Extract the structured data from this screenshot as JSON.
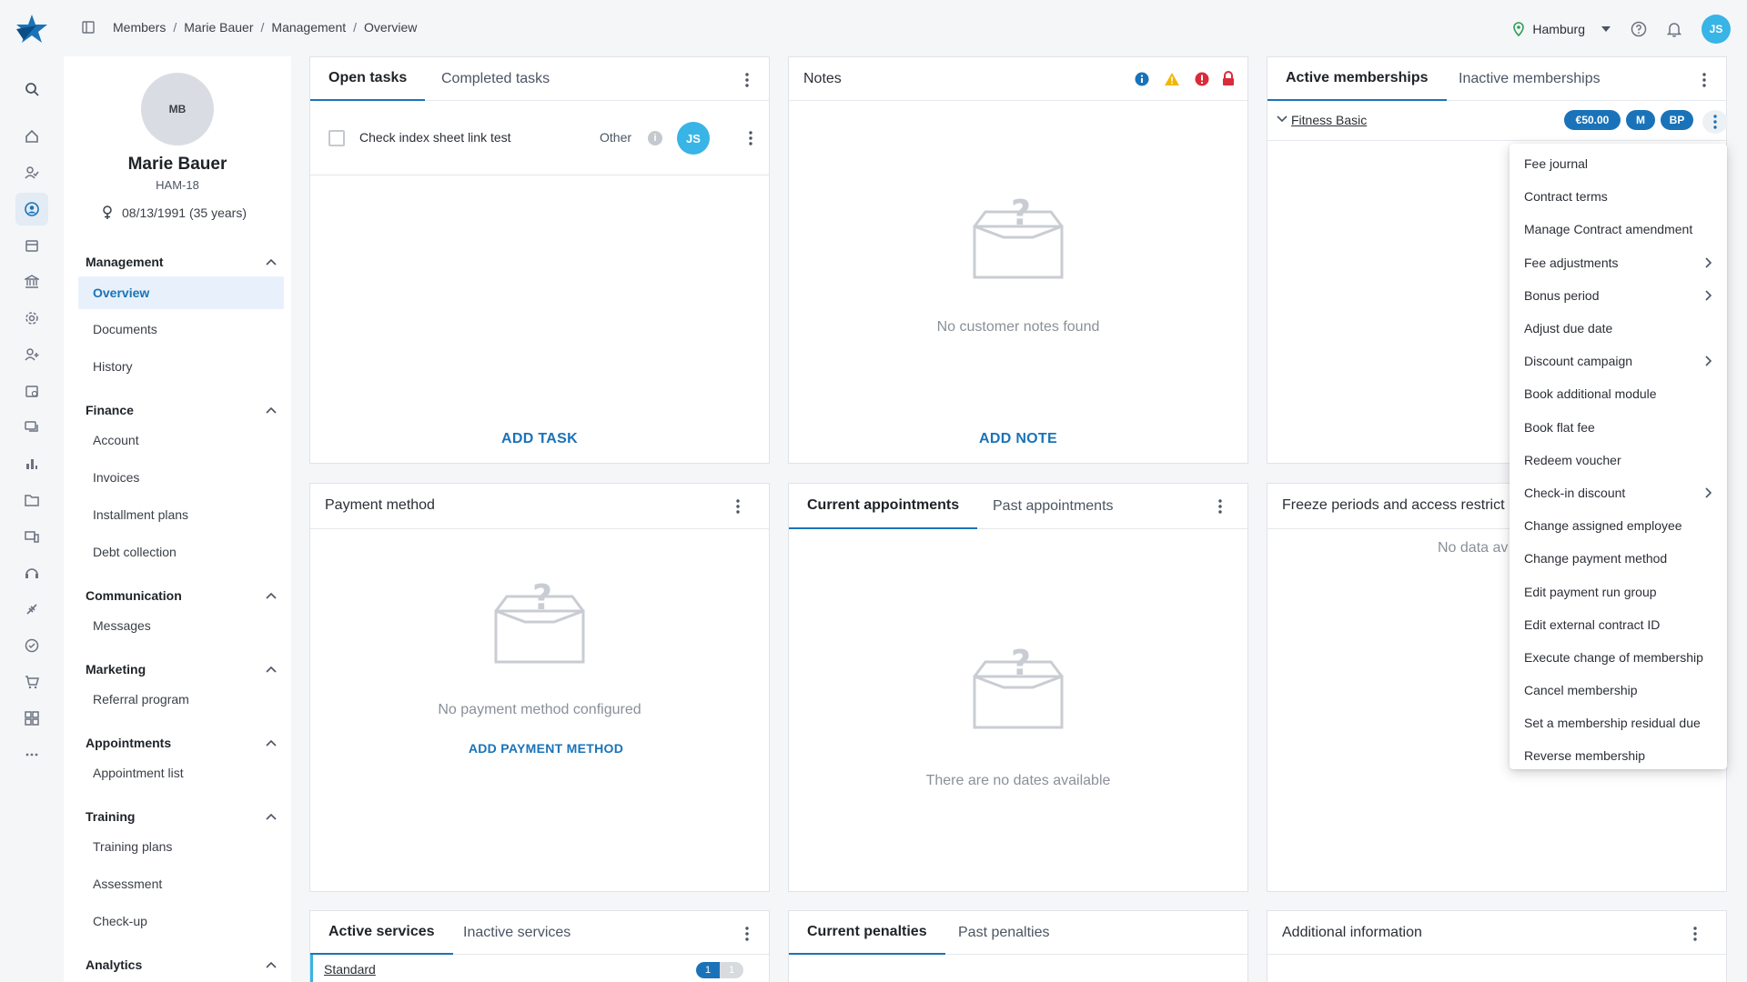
{
  "breadcrumb": [
    "Members",
    "Marie Bauer",
    "Management",
    "Overview"
  ],
  "breadcrumb_sep": "/",
  "topbar": {
    "studio": "Hamburg",
    "user_initials": "JS"
  },
  "member": {
    "initials": "MB",
    "name": "Marie Bauer",
    "id": "HAM-18",
    "dob": "08/13/1991 (35 years)"
  },
  "nav": {
    "management": {
      "label": "Management",
      "items": [
        "Overview",
        "Documents",
        "History"
      ]
    },
    "finance": {
      "label": "Finance",
      "items": [
        "Account",
        "Invoices",
        "Installment plans",
        "Debt collection"
      ]
    },
    "communication": {
      "label": "Communication",
      "items": [
        "Messages"
      ]
    },
    "marketing": {
      "label": "Marketing",
      "items": [
        "Referral program"
      ]
    },
    "appointments": {
      "label": "Appointments",
      "items": [
        "Appointment list"
      ]
    },
    "training": {
      "label": "Training",
      "items": [
        "Training plans",
        "Assessment",
        "Check-up"
      ]
    },
    "analytics": {
      "label": "Analytics"
    }
  },
  "tasks": {
    "tabs": [
      "Open tasks",
      "Completed tasks"
    ],
    "row": {
      "text": "Check index sheet link test",
      "category": "Other",
      "assignee": "JS",
      "info": "i"
    },
    "action": "ADD TASK"
  },
  "notes": {
    "title": "Notes",
    "empty": "No customer notes found",
    "action": "ADD NOTE"
  },
  "memberships": {
    "tabs": [
      "Active memberships",
      "Inactive memberships"
    ],
    "row": {
      "name": "Fitness Basic",
      "price": "€50.00",
      "badge1": "M",
      "badge2": "BP"
    },
    "menu": [
      {
        "label": "Fee journal",
        "sub": false
      },
      {
        "label": "Contract terms",
        "sub": false
      },
      {
        "label": "Manage Contract amendment",
        "sub": false
      },
      {
        "label": "Fee adjustments",
        "sub": true
      },
      {
        "label": "Bonus period",
        "sub": true
      },
      {
        "label": "Adjust due date",
        "sub": false
      },
      {
        "label": "Discount campaign",
        "sub": true
      },
      {
        "label": "Book additional module",
        "sub": false
      },
      {
        "label": "Book flat fee",
        "sub": false
      },
      {
        "label": "Redeem voucher",
        "sub": false
      },
      {
        "label": "Check-in discount",
        "sub": true
      },
      {
        "label": "Change assigned employee",
        "sub": false
      },
      {
        "label": "Change payment method",
        "sub": false
      },
      {
        "label": "Edit payment run group",
        "sub": false
      },
      {
        "label": "Edit external contract ID",
        "sub": false
      },
      {
        "label": "Execute change of membership",
        "sub": false
      },
      {
        "label": "Cancel membership",
        "sub": false
      },
      {
        "label": "Set a membership residual due",
        "sub": false
      },
      {
        "label": "Reverse membership",
        "sub": false
      }
    ]
  },
  "payment": {
    "title": "Payment method",
    "empty": "No payment method configured",
    "action": "ADD PAYMENT METHOD"
  },
  "appointments_card": {
    "tabs": [
      "Current appointments",
      "Past appointments"
    ],
    "empty": "There are no dates available"
  },
  "freeze": {
    "title": "Freeze periods and access restrict",
    "empty": "No data av"
  },
  "services": {
    "tabs": [
      "Active services",
      "Inactive services"
    ],
    "row": {
      "name": "Standard",
      "count_a": "1",
      "count_b": "1"
    }
  },
  "penalties": {
    "tabs": [
      "Current penalties",
      "Past penalties"
    ]
  },
  "additional": {
    "title": "Additional information"
  },
  "colors": {
    "accent": "#1a73b8",
    "avatar": "#38b4e6",
    "warning": "#f2b705",
    "error": "#d92b3a"
  }
}
